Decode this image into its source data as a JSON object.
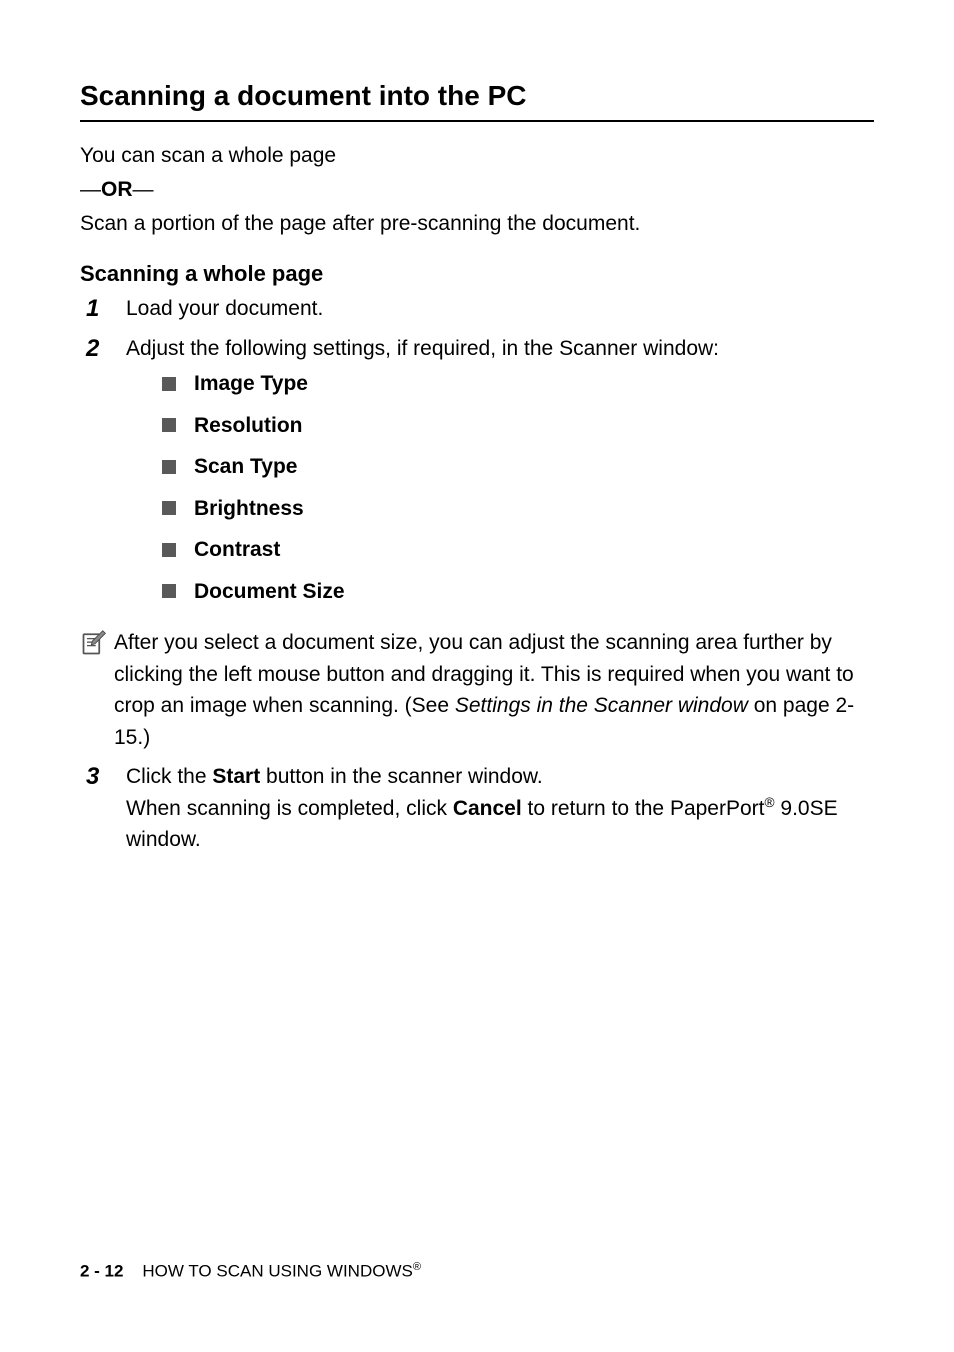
{
  "heading": "Scanning a document into the PC",
  "intro": {
    "line1": "You can scan a whole page",
    "or_before": "—",
    "or_text": "OR",
    "or_after": "—",
    "line2": "Scan a portion of the page after pre-scanning the document."
  },
  "subheading": "Scanning a whole page",
  "steps": {
    "s1": {
      "num": "1",
      "text": "Load your document."
    },
    "s2": {
      "num": "2",
      "text": "Adjust the following settings, if required, in the Scanner window:"
    },
    "s3": {
      "num": "3",
      "click_the": "Click the ",
      "start": "Start",
      "after_start": " button in the scanner window.",
      "when_scanning": "When scanning is completed, click ",
      "cancel": "Cancel",
      "after_cancel": " to return to the PaperPort",
      "reg": "®",
      "window_end": " 9.0SE window."
    }
  },
  "bullets": {
    "b1": "Image Type",
    "b2": "Resolution",
    "b3": "Scan Type",
    "b4": "Brightness",
    "b5": "Contrast",
    "b6": "Document Size"
  },
  "note": {
    "part1": "After you select a document size, you can adjust the scanning area further by clicking the left mouse button and dragging it. This is required when you want to crop an image when scanning. (See ",
    "linktext": "Settings in the Scanner window",
    "part2": " on page 2-15.)"
  },
  "footer": {
    "page": "2 - 12",
    "chapter": "HOW TO SCAN USING WINDOWS",
    "reg": "®"
  }
}
